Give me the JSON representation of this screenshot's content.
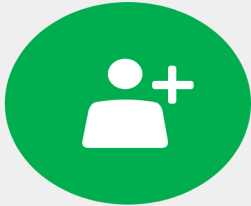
{
  "button": {
    "icon": "add-user-icon",
    "background_color": "#00ae50",
    "icon_color": "#ffffff"
  },
  "page": {
    "background_color": "#efefef"
  }
}
